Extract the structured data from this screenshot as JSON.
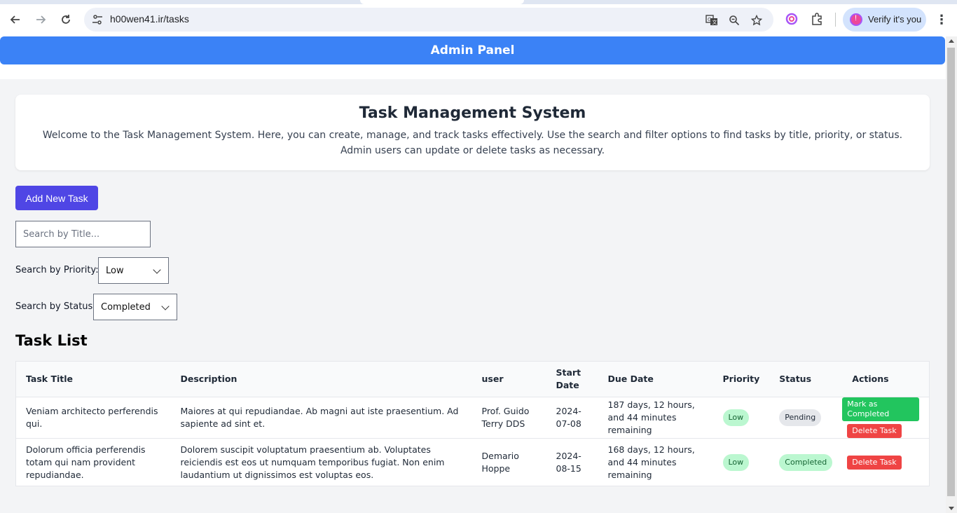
{
  "browser": {
    "url": "h00wen41.ir/tasks",
    "profile_label": "Verify it's you"
  },
  "header": {
    "title": "Admin Panel"
  },
  "intro": {
    "title": "Task Management System",
    "text": "Welcome to the Task Management System. Here, you can create, manage, and track tasks effectively. Use the search and filter options to find tasks by title, priority, or status. Admin users can update or delete tasks as necessary."
  },
  "add_button": "Add New Task",
  "search": {
    "placeholder": "Search by Title..."
  },
  "filters": {
    "priority_label": "Search by Priority:",
    "priority_value": "Low",
    "status_label": "Search by Status:",
    "status_value": "Completed"
  },
  "task_list": {
    "title": "Task List",
    "columns": [
      "Task Title",
      "Description",
      "user",
      "Start Date",
      "Due Date",
      "Priority",
      "Status",
      "Actions"
    ],
    "rows": [
      {
        "title": "Veniam architecto perferendis qui.",
        "description": "Maiores at qui repudiandae. Ab magni aut iste praesentium. Ad sapiente ad sint et.",
        "user": "Prof. Guido Terry DDS",
        "start": "2024-07-08",
        "due": "187 days, 12 hours, and 44 minutes remaining",
        "priority": "Low",
        "status": "Pending",
        "complete_label": "Mark as Completed",
        "delete_label": "Delete Task"
      },
      {
        "title": "Dolorum officia perferendis totam qui nam provident repudiandae.",
        "description": "Dolorem suscipit voluptatum praesentium ab. Voluptates reiciendis est eos ut numquam temporibus fugiat. Non enim laudantium ut dignissimos est voluptas eos.",
        "user": "Demario Hoppe",
        "start": "2024-08-15",
        "due": "168 days, 12 hours, and 44 minutes remaining",
        "priority": "Low",
        "status": "Completed",
        "delete_label": "Delete Task"
      }
    ]
  },
  "colors": {
    "header": "#3b82f6",
    "add_button": "#4f46e5",
    "success": "#22c55e",
    "danger": "#ef4444"
  },
  "icons": [
    "back-icon",
    "forward-icon",
    "reload-icon",
    "site-settings-icon",
    "translate-icon",
    "zoom-icon",
    "star-icon",
    "extension-icon",
    "puzzle-icon",
    "profile-avatar",
    "kebab-menu-icon",
    "chevron-down-icon"
  ]
}
